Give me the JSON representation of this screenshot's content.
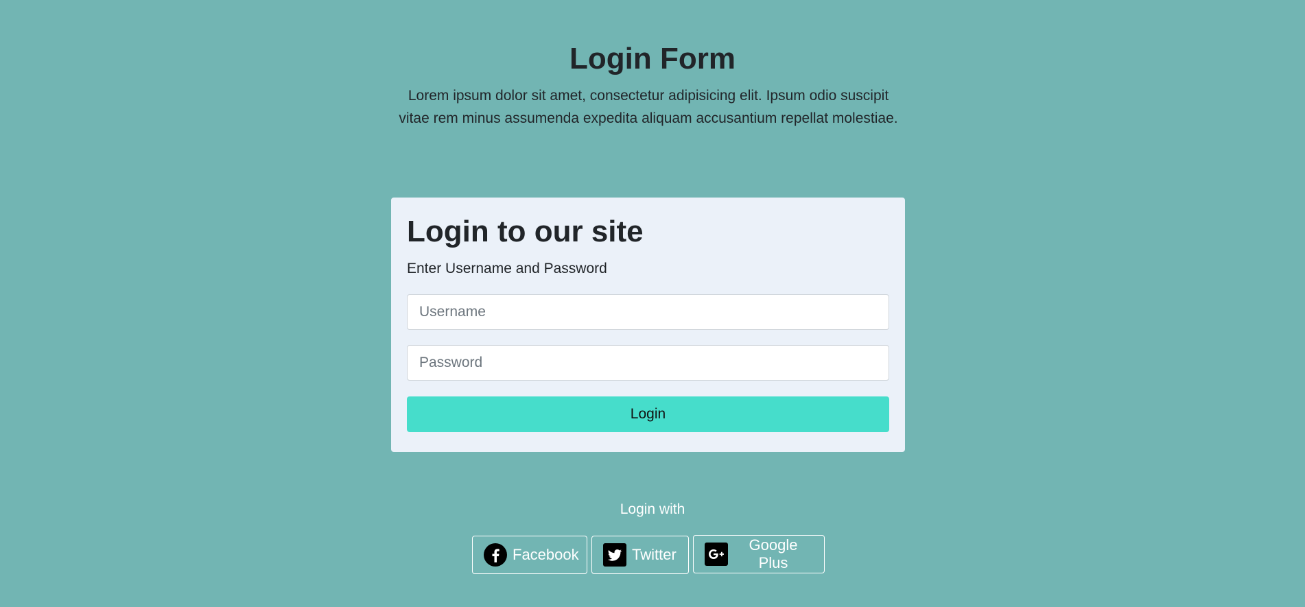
{
  "header": {
    "title": "Login Form",
    "intro": "Lorem ipsum dolor sit amet, consectetur adipisicing elit. Ipsum odio suscipit vitae rem minus assumenda expedita aliquam accusantium repellat molestiae."
  },
  "card": {
    "title": "Login to our site",
    "subtitle": "Enter Username and Password",
    "username_placeholder": "Username",
    "password_placeholder": "Password",
    "login_label": "Login"
  },
  "social": {
    "heading": "Login with",
    "buttons": [
      {
        "label": "Facebook",
        "icon": "facebook-icon"
      },
      {
        "label": "Twitter",
        "icon": "twitter-icon"
      },
      {
        "label": "Google Plus",
        "icon": "google-plus-icon"
      }
    ]
  },
  "colors": {
    "background": "#72b5b3",
    "card": "#ebf1f9",
    "accent": "#46ddcb",
    "text": "#212529"
  }
}
